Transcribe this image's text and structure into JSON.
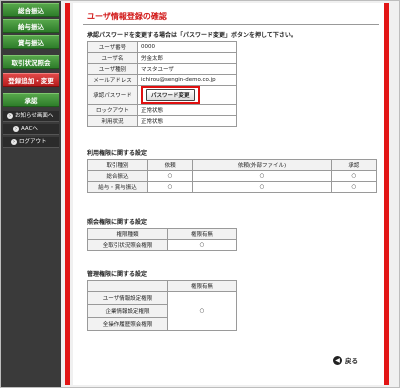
{
  "sidebar": {
    "items": [
      {
        "label": "総合振込",
        "active": false
      },
      {
        "label": "給与振込",
        "active": false
      },
      {
        "label": "賞与振込",
        "active": false
      },
      {
        "label": "取引状況照会",
        "active": false
      },
      {
        "label": "登録追加・変更",
        "active": true
      },
      {
        "label": "承認",
        "active": false
      }
    ],
    "subitems": [
      {
        "label": "お知らせ画面へ"
      },
      {
        "label": "AACへ"
      },
      {
        "label": "ログアウト"
      }
    ]
  },
  "page": {
    "title": "ユーザ情報登録の確認",
    "note": "承認パスワードを変更する場合は「パスワード変更」ボタンを押して下さい。"
  },
  "user_info": {
    "rows": [
      {
        "label": "ユーザ番号",
        "value": "0000"
      },
      {
        "label": "ユーザ名",
        "value": "労金太郎"
      },
      {
        "label": "ユーザ種別",
        "value": "マスタユーザ"
      },
      {
        "label": "メールアドレス",
        "value": "ichirou@sengin-demo.co.jp"
      },
      {
        "label": "承認パスワード",
        "value": ""
      },
      {
        "label": "ロックアウト",
        "value": "正常状態"
      },
      {
        "label": "利用状況",
        "value": "正常状態"
      }
    ],
    "password_button": "パスワード変更"
  },
  "usage_section": {
    "title": "利用権限に関する設定",
    "headers": [
      "取引種別",
      "依頼",
      "依頼(外部ファイル)",
      "承認"
    ],
    "rows": [
      {
        "label": "総合振込",
        "cells": [
          "○",
          "○",
          "○"
        ]
      },
      {
        "label": "給与・賞与振込",
        "cells": [
          "○",
          "○",
          "○"
        ]
      }
    ]
  },
  "inquiry_section": {
    "title": "照会権限に関する設定",
    "headers": [
      "権限種類",
      "権限有無"
    ],
    "rows": [
      {
        "label": "全取引状況照会権限",
        "cell": "○"
      }
    ]
  },
  "admin_section": {
    "title": "管理権限に関する設定",
    "headers": [
      "",
      "権限有無"
    ],
    "rows": [
      {
        "label": "ユーザ情報設定権限"
      },
      {
        "label": "企業情報設定権限"
      },
      {
        "label": "全操作履歴照会権限"
      }
    ],
    "cell": "○"
  },
  "back_button": {
    "label": "戻る",
    "icon": "back-arrow-icon"
  },
  "colors": {
    "accent": "#e21515",
    "nav_green": "#3f8f36",
    "nav_active": "#c62828"
  }
}
